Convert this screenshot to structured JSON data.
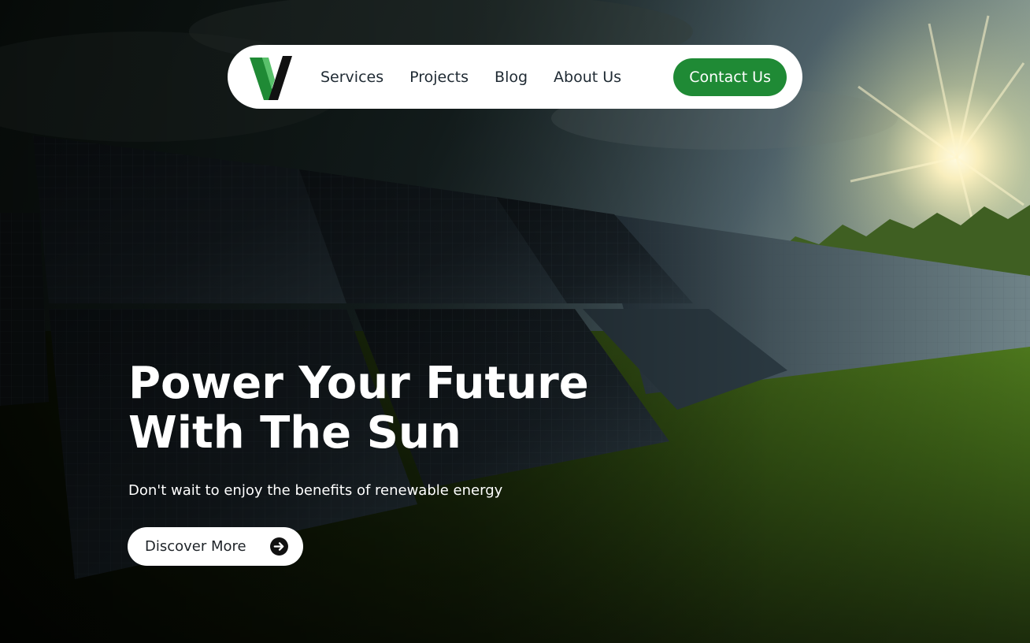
{
  "nav": {
    "logo_icon": "brand-v-logo",
    "links": [
      {
        "label": "Services"
      },
      {
        "label": "Projects"
      },
      {
        "label": "Blog"
      },
      {
        "label": "About Us"
      }
    ],
    "cta_label": "Contact Us"
  },
  "hero": {
    "headline_line1": "Power Your Future",
    "headline_line2": "With The Sun",
    "subheadline": "Don't wait to enjoy the benefits of renewable energy",
    "button_label": "Discover More",
    "button_icon": "arrow-circle-right-icon",
    "background_image": "solar-panels-field-at-sunset"
  },
  "colors": {
    "accent_green": "#1f8a35",
    "nav_background": "#ffffff",
    "text_dark": "#1f2a33",
    "hero_text": "#ffffff"
  }
}
